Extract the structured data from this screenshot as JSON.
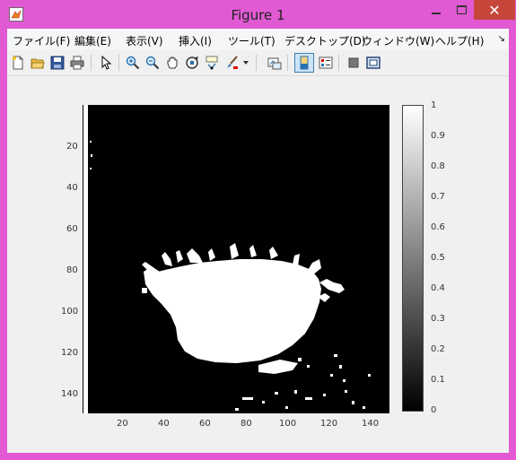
{
  "window": {
    "title": "Figure 1",
    "close_glyph": "✕"
  },
  "menu": [
    "ファイル(F)",
    "編集(E)",
    "表示(V)",
    "挿入(I)",
    "ツール(T)",
    "デスクトップ(D)",
    "ウィンドウ(W)",
    "ヘルプ(H)"
  ],
  "toolbar": [
    "new-figure-icon",
    "open-file-icon",
    "save-icon",
    "print-icon",
    "pointer-icon",
    "zoom-in-icon",
    "zoom-out-icon",
    "pan-icon",
    "rotate-3d-icon",
    "data-cursor-icon",
    "brush-icon",
    "link-plot-icon",
    "colorbar-icon",
    "legend-icon",
    "hide-plot-tools-icon",
    "show-plot-tools-icon"
  ],
  "image_axes": {
    "y_ticks": [
      "20",
      "40",
      "60",
      "80",
      "100",
      "120",
      "140"
    ],
    "x_ticks": [
      "20",
      "40",
      "60",
      "80",
      "100",
      "120",
      "140"
    ]
  },
  "colorbar": {
    "ticks": [
      "1",
      "0.9",
      "0.8",
      "0.7",
      "0.6",
      "0.5",
      "0.4",
      "0.3",
      "0.2",
      "0.1",
      "0"
    ],
    "colormap": "gray",
    "range": [
      0,
      1
    ]
  },
  "colors": {
    "titlebar": "#e15ad3",
    "close": "#c7463b",
    "background": "#f0f0f0"
  }
}
